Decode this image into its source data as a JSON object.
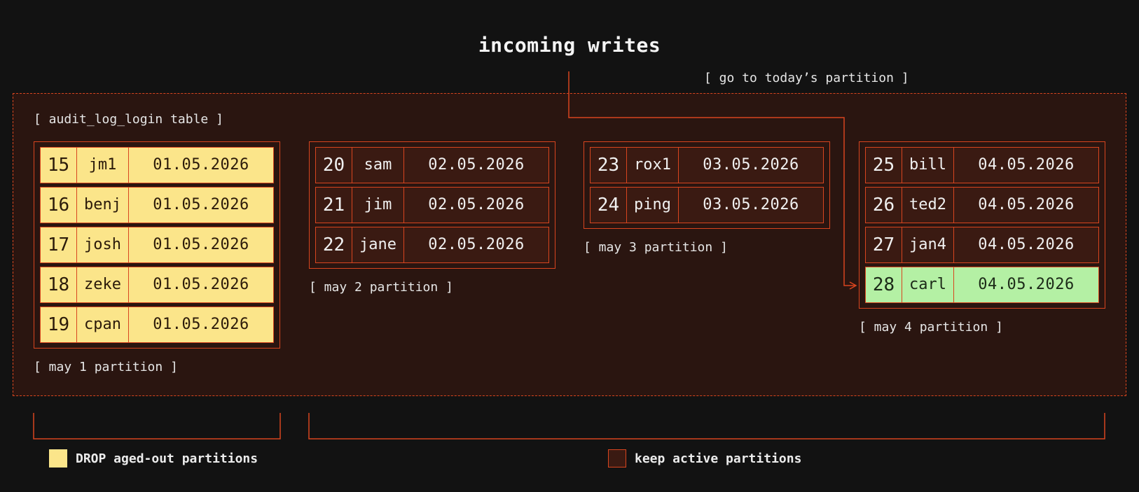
{
  "title": "incoming writes",
  "route_label": "[ go to today’s partition ]",
  "table_label": "[ audit_log_login table ]",
  "colors": {
    "background": "#121212",
    "accent": "#d8451f",
    "table_fill": "#2a1510",
    "drop_fill": "#fbe58a",
    "active_fill": "#3a1a12",
    "new_row_fill": "#b4f0a4"
  },
  "partitions": [
    {
      "label": "[ may 1 partition ]",
      "status": "drop",
      "rows": [
        {
          "id": "15",
          "name": "jm1",
          "date": "01.05.2026"
        },
        {
          "id": "16",
          "name": "benj",
          "date": "01.05.2026"
        },
        {
          "id": "17",
          "name": "josh",
          "date": "01.05.2026"
        },
        {
          "id": "18",
          "name": "zeke",
          "date": "01.05.2026"
        },
        {
          "id": "19",
          "name": "cpan",
          "date": "01.05.2026"
        }
      ]
    },
    {
      "label": "[ may 2 partition ]",
      "status": "active",
      "rows": [
        {
          "id": "20",
          "name": "sam",
          "date": "02.05.2026"
        },
        {
          "id": "21",
          "name": "jim",
          "date": "02.05.2026"
        },
        {
          "id": "22",
          "name": "jane",
          "date": "02.05.2026"
        }
      ]
    },
    {
      "label": "[ may 3 partition ]",
      "status": "active",
      "rows": [
        {
          "id": "23",
          "name": "rox1",
          "date": "03.05.2026"
        },
        {
          "id": "24",
          "name": "ping",
          "date": "03.05.2026"
        }
      ]
    },
    {
      "label": "[ may 4 partition ]",
      "status": "active",
      "rows": [
        {
          "id": "25",
          "name": "bill",
          "date": "04.05.2026"
        },
        {
          "id": "26",
          "name": "ted2",
          "date": "04.05.2026"
        },
        {
          "id": "27",
          "name": "jan4",
          "date": "04.05.2026"
        },
        {
          "id": "28",
          "name": "carl",
          "date": "04.05.2026",
          "highlight": "new"
        }
      ]
    }
  ],
  "legend": [
    {
      "label": "DROP aged-out partitions",
      "swatch": "drop"
    },
    {
      "label": "keep active partitions",
      "swatch": "active"
    }
  ]
}
